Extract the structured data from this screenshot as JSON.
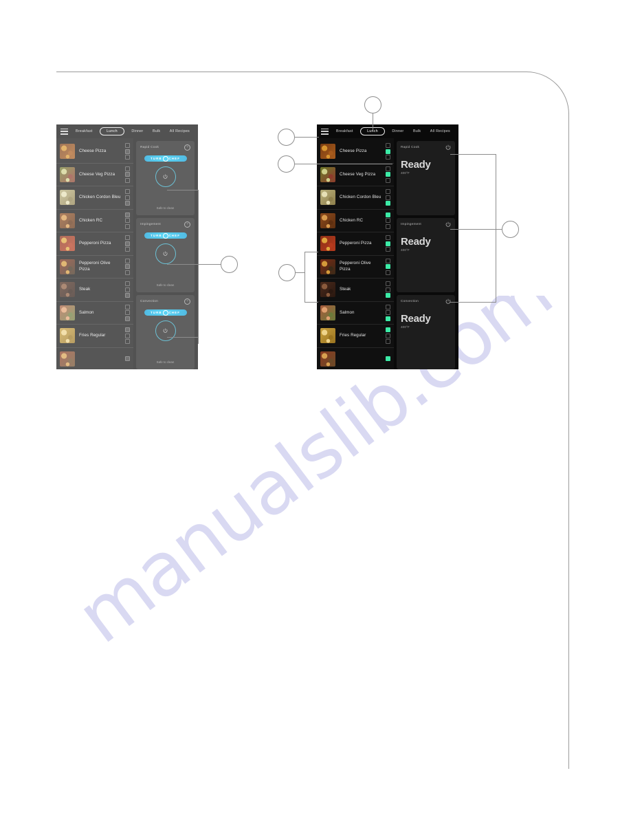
{
  "document": {
    "watermark": "manualslib.com"
  },
  "app": {
    "nav": {
      "menu_icon": "hamburger-icon",
      "tabs": [
        {
          "label": "Breakfast",
          "active": false
        },
        {
          "label": "Lunch",
          "active": true
        },
        {
          "label": "Dinner",
          "active": false
        },
        {
          "label": "Bulk",
          "active": false
        },
        {
          "label": "All Recipes",
          "active": false
        }
      ]
    },
    "recipes": [
      {
        "label": "Cheese Pizza",
        "indicators": [
          "off",
          "on",
          "off"
        ],
        "thumb": "cheese-pizza-thumb"
      },
      {
        "label": "Cheese Veg Pizza",
        "indicators": [
          "off",
          "on",
          "off"
        ],
        "thumb": "cheese-veg-pizza-thumb"
      },
      {
        "label": "Chicken Cordon Bleu",
        "indicators": [
          "off",
          "off",
          "on"
        ],
        "thumb": "chicken-cordon-bleu-thumb"
      },
      {
        "label": "Chicken RC",
        "indicators": [
          "on",
          "off",
          "off"
        ],
        "thumb": "chicken-rc-thumb"
      },
      {
        "label": "Pepperoni Pizza",
        "indicators": [
          "off",
          "on",
          "off"
        ],
        "thumb": "pepperoni-pizza-thumb"
      },
      {
        "label": "Pepperoni Olive Pizza",
        "indicators": [
          "off",
          "on",
          "off"
        ],
        "thumb": "pepperoni-olive-pizza-thumb"
      },
      {
        "label": "Steak",
        "indicators": [
          "off",
          "off",
          "on"
        ],
        "thumb": "steak-thumb"
      },
      {
        "label": "Salmon",
        "indicators": [
          "off",
          "off",
          "on"
        ],
        "thumb": "salmon-thumb"
      },
      {
        "label": "Fries Regular",
        "indicators": [
          "on",
          "off",
          "off"
        ],
        "thumb": "fries-regular-thumb"
      },
      {
        "label": "",
        "indicators": [
          "on"
        ],
        "thumb": "partial-row-thumb"
      }
    ],
    "ovens_idle": [
      {
        "title": "Rapid Cook",
        "logo": "TURBOCHEF",
        "status": "Safe to clean",
        "help_icon": "question-mark-icon",
        "dial_icon": "power-icon"
      },
      {
        "title": "Impingement",
        "logo": "TURBOCHEF",
        "status": "Safe to clean",
        "help_icon": "question-mark-icon",
        "dial_icon": "power-icon"
      },
      {
        "title": "Convection",
        "logo": "TURBOCHEF",
        "status": "Safe to clean",
        "help_icon": "question-mark-icon",
        "dial_icon": "power-icon"
      }
    ],
    "ovens_ready": [
      {
        "title": "Rapid Cook",
        "status": "Ready",
        "temperature": "400°F",
        "power_icon": "power-icon"
      },
      {
        "title": "Impingement",
        "status": "Ready",
        "temperature": "400°F",
        "power_icon": "power-icon"
      },
      {
        "title": "Convection",
        "status": "Ready",
        "temperature": "400°F",
        "power_icon": "power-icon"
      }
    ]
  },
  "callouts": [
    {
      "id": "callout-menu",
      "label": ""
    },
    {
      "id": "callout-recipe",
      "label": ""
    },
    {
      "id": "callout-tab",
      "label": ""
    },
    {
      "id": "callout-list-left",
      "label": ""
    },
    {
      "id": "callout-dial-left",
      "label": ""
    },
    {
      "id": "callout-power",
      "label": ""
    }
  ],
  "colors": {
    "indicator_on": "#3ceaa6",
    "brand_blue": "#14c3f0",
    "panel_bg": "#1d1d1d",
    "screen_bg": "#000000",
    "watermark": "#d9d9f2",
    "rule": "#9a9a9a"
  }
}
